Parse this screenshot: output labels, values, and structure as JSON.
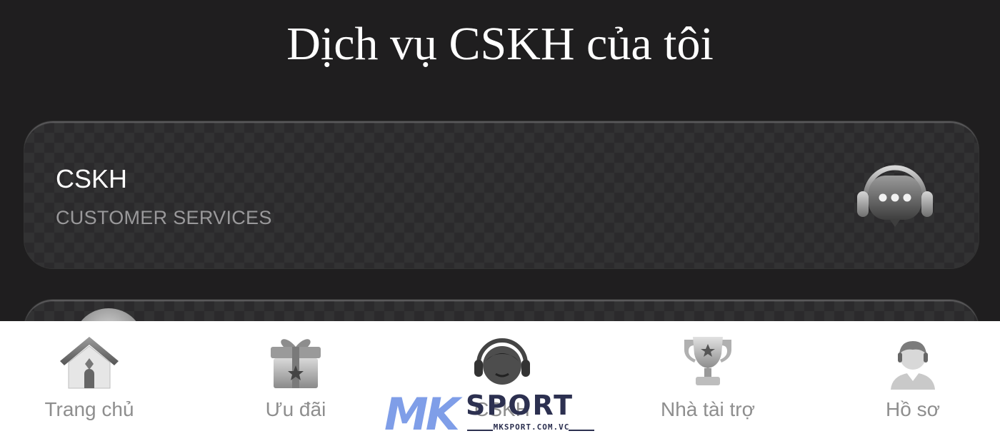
{
  "header": {
    "title": "Dịch vụ CSKH của tôi"
  },
  "cards": [
    {
      "title": "CSKH",
      "subtitle": "CUSTOMER SERVICES",
      "icon": "headset-chat-icon"
    }
  ],
  "bottom_nav": {
    "items": [
      {
        "label": "Trang chủ",
        "icon": "home-icon"
      },
      {
        "label": "Ưu đãi",
        "icon": "gift-icon"
      },
      {
        "label": "CSKH",
        "icon": "support-agent-icon"
      },
      {
        "label": "Nhà tài trợ",
        "icon": "trophy-icon"
      },
      {
        "label": "Hồ sơ",
        "icon": "profile-icon"
      }
    ]
  },
  "watermark": {
    "brand_mk": "MK",
    "brand_sport": "SPORT",
    "domain": "MKSPORT.COM.VC"
  },
  "colors": {
    "background": "#1f1e1f",
    "card": "#2b2a2c",
    "nav_bg": "#ffffff",
    "nav_label": "#8e8e8e",
    "watermark_blue": "#7f9ee8",
    "watermark_navy": "#2c3050"
  }
}
